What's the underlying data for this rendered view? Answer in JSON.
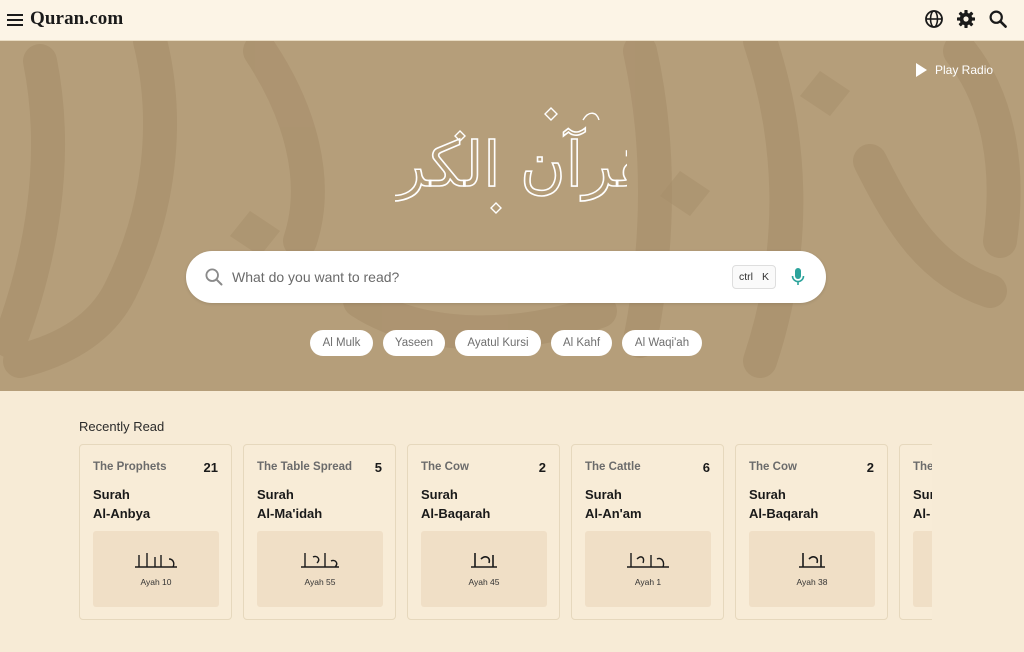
{
  "header": {
    "logo": "Quran.com",
    "icons": [
      "menu-icon",
      "globe-icon",
      "gear-icon",
      "search-icon"
    ]
  },
  "hero": {
    "play_radio": "Play Radio",
    "calligraphy": "القرآن الكريم",
    "search": {
      "placeholder": "What do you want to read?",
      "shortcut_ctrl": "ctrl",
      "shortcut_key": "K"
    },
    "chips": [
      "Al Mulk",
      "Yaseen",
      "Ayatul Kursi",
      "Al Kahf",
      "Al Waqi'ah"
    ]
  },
  "recent": {
    "title": "Recently Read",
    "cards": [
      {
        "name": "The Prophets",
        "number": "21",
        "line1": "Surah",
        "line2": "Al-Anbya",
        "ayah": "Ayah 10"
      },
      {
        "name": "The Table Spread",
        "number": "5",
        "line1": "Surah",
        "line2": "Al-Ma'idah",
        "ayah": "Ayah 55"
      },
      {
        "name": "The Cow",
        "number": "2",
        "line1": "Surah",
        "line2": "Al-Baqarah",
        "ayah": "Ayah 45"
      },
      {
        "name": "The Cattle",
        "number": "6",
        "line1": "Surah",
        "line2": "Al-An'am",
        "ayah": "Ayah 1"
      },
      {
        "name": "The Cow",
        "number": "2",
        "line1": "Surah",
        "line2": "Al-Baqarah",
        "ayah": "Ayah 38"
      },
      {
        "name": "The",
        "number": "",
        "line1": "Sur",
        "line2": "Al-",
        "ayah": ""
      }
    ]
  },
  "colors": {
    "page_bg": "#f7ebd6",
    "header_bg": "#fcf4e6",
    "hero_bg": "#b59e7a",
    "mic_accent": "#2ba39b"
  }
}
